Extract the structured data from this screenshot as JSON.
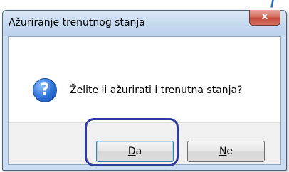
{
  "dialog": {
    "title": "Ažuriranje trenutnog stanja",
    "message": "Želite li ažurirati i trenutna stanja?",
    "close_glyph": "x",
    "icon": "question-icon",
    "question_glyph": "?"
  },
  "buttons": {
    "yes": {
      "prefix": "D",
      "rest": "a"
    },
    "no": {
      "prefix": "N",
      "rest": "e"
    }
  },
  "corner_glyph": "/",
  "colors": {
    "highlight": "#2f3b9e",
    "close_button": "#d0705f",
    "title_bar": "#c5d9ef"
  }
}
